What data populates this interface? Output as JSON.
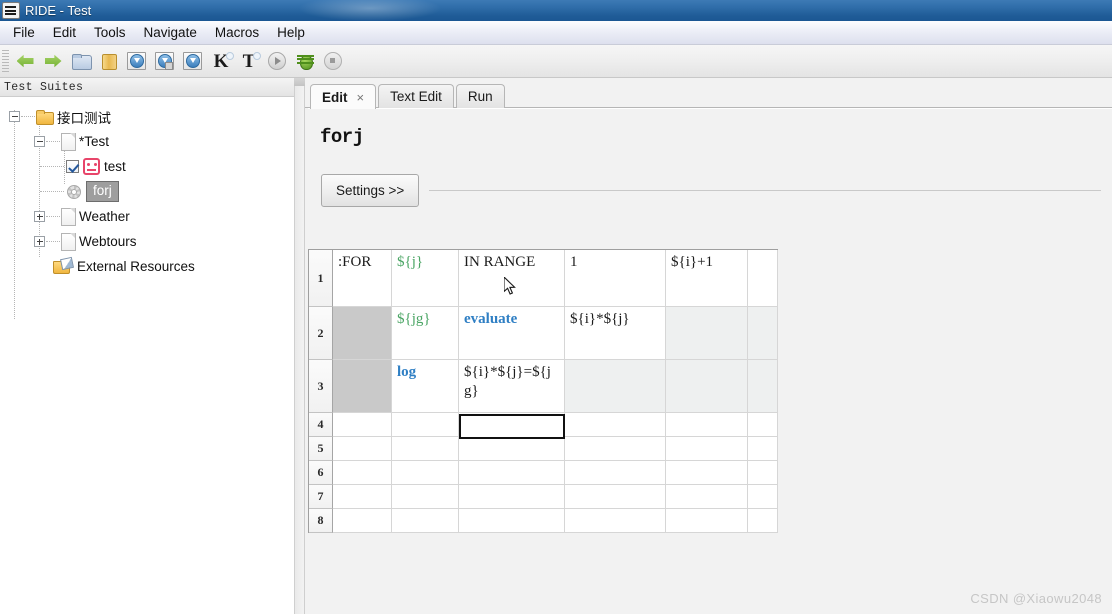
{
  "window": {
    "title": "RIDE - Test",
    "icon": "ride-app-icon"
  },
  "menubar": {
    "items": [
      {
        "label": "File"
      },
      {
        "label": "Edit"
      },
      {
        "label": "Tools"
      },
      {
        "label": "Navigate"
      },
      {
        "label": "Macros"
      },
      {
        "label": "Help"
      }
    ]
  },
  "toolbar": {
    "buttons": [
      {
        "name": "back-button",
        "icon": "arrow-left-icon"
      },
      {
        "name": "forward-button",
        "icon": "arrow-right-icon"
      },
      {
        "name": "open-directory-button",
        "icon": "folder-open-icon"
      },
      {
        "name": "open-file-button",
        "icon": "folder-yellow-icon"
      },
      {
        "name": "save-button",
        "icon": "save-icon"
      },
      {
        "name": "save-all-button",
        "icon": "save-all-icon"
      },
      {
        "name": "save-as-button",
        "icon": "save-as-icon"
      },
      {
        "name": "search-keyword-button",
        "icon": "letter-k-icon"
      },
      {
        "name": "search-tests-button",
        "icon": "letter-t-icon"
      },
      {
        "name": "run-button",
        "icon": "play-icon"
      },
      {
        "name": "debug-button",
        "icon": "bug-icon"
      },
      {
        "name": "stop-button",
        "icon": "stop-icon"
      }
    ]
  },
  "sidebar": {
    "header": "Test Suites",
    "tree": [
      {
        "label": "接口测试",
        "icon": "folder-icon",
        "expander": "minus",
        "level": 0
      },
      {
        "label": "*Test",
        "icon": "file-icon",
        "expander": "minus",
        "level": 1
      },
      {
        "label": "test",
        "icon": "robot-test-icon",
        "expander": "none",
        "level": 2,
        "checkbox": true
      },
      {
        "label": "forj",
        "icon": "gear-icon",
        "expander": "none",
        "level": 2,
        "selected": true
      },
      {
        "label": "Weather",
        "icon": "file-icon",
        "expander": "plus",
        "level": 1
      },
      {
        "label": "Webtours",
        "icon": "file-icon",
        "expander": "plus",
        "level": 1
      },
      {
        "label": "External Resources",
        "icon": "external-resources-icon",
        "expander": "none",
        "level": 1
      }
    ]
  },
  "editor": {
    "tabs": [
      {
        "label": "Edit",
        "active": true,
        "closable": true,
        "close_glyph": "×"
      },
      {
        "label": "Text Edit",
        "active": false,
        "closable": false
      },
      {
        "label": "Run",
        "active": false,
        "closable": false
      }
    ],
    "keyword_name": "forj",
    "settings_button": "Settings >>",
    "grid": {
      "row_numbers": [
        "1",
        "2",
        "3",
        "4",
        "5",
        "6",
        "7",
        "8"
      ],
      "rows": [
        {
          "num": "1",
          "tint": false,
          "cells": [
            {
              "text": ":FOR",
              "style": "plain"
            },
            {
              "text": "${j}",
              "style": "var"
            },
            {
              "text": "IN RANGE",
              "style": "plain"
            },
            {
              "text": "1",
              "style": "plain"
            },
            {
              "text": "${i}+1",
              "style": "plain"
            },
            {
              "text": "",
              "style": "plain"
            }
          ]
        },
        {
          "num": "2",
          "tint": true,
          "cells": [
            {
              "text": "",
              "style": "forbar"
            },
            {
              "text": "${jg}",
              "style": "var"
            },
            {
              "text": "evaluate",
              "style": "keyword"
            },
            {
              "text": "${i}*${j}",
              "style": "plain"
            },
            {
              "text": "",
              "style": "plain"
            },
            {
              "text": "",
              "style": "plain"
            }
          ]
        },
        {
          "num": "3",
          "tint": true,
          "cells": [
            {
              "text": "",
              "style": "forbar"
            },
            {
              "text": "log",
              "style": "keyword"
            },
            {
              "text": "${i}*${j}=${jg}",
              "style": "plain"
            },
            {
              "text": "",
              "style": "plain"
            },
            {
              "text": "",
              "style": "plain"
            },
            {
              "text": "",
              "style": "plain"
            }
          ]
        },
        {
          "num": "4",
          "tint": false,
          "cells": [
            {
              "text": "",
              "style": "plain"
            },
            {
              "text": "",
              "style": "plain"
            },
            {
              "text": "",
              "style": "plain"
            },
            {
              "text": "",
              "style": "plain"
            },
            {
              "text": "",
              "style": "plain"
            },
            {
              "text": "",
              "style": "plain"
            }
          ]
        },
        {
          "num": "5",
          "tint": false,
          "cells": [
            {
              "text": "",
              "style": "plain"
            },
            {
              "text": "",
              "style": "plain"
            },
            {
              "text": "",
              "style": "plain"
            },
            {
              "text": "",
              "style": "plain"
            },
            {
              "text": "",
              "style": "plain"
            },
            {
              "text": "",
              "style": "plain"
            }
          ]
        },
        {
          "num": "6",
          "tint": false,
          "cells": [
            {
              "text": "",
              "style": "plain"
            },
            {
              "text": "",
              "style": "plain"
            },
            {
              "text": "",
              "style": "plain"
            },
            {
              "text": "",
              "style": "plain"
            },
            {
              "text": "",
              "style": "plain"
            },
            {
              "text": "",
              "style": "plain"
            }
          ]
        },
        {
          "num": "7",
          "tint": false,
          "cells": [
            {
              "text": "",
              "style": "plain"
            },
            {
              "text": "",
              "style": "plain"
            },
            {
              "text": "",
              "style": "plain"
            },
            {
              "text": "",
              "style": "plain"
            },
            {
              "text": "",
              "style": "plain"
            },
            {
              "text": "",
              "style": "plain"
            }
          ]
        },
        {
          "num": "8",
          "tint": false,
          "cells": [
            {
              "text": "",
              "style": "plain"
            },
            {
              "text": "",
              "style": "plain"
            },
            {
              "text": "",
              "style": "plain"
            },
            {
              "text": "",
              "style": "plain"
            },
            {
              "text": "",
              "style": "plain"
            },
            {
              "text": "",
              "style": "plain"
            }
          ]
        }
      ],
      "selected_cell": {
        "row": "4",
        "column": "2"
      }
    }
  },
  "watermark": "CSDN @Xiaowu2048",
  "colors": {
    "titlebar": "#2f6da9",
    "variable_green": "#4aa564",
    "keyword_blue": "#2f7fc4",
    "selection_gray": "#9e9e9e",
    "for_bar_gray": "#c9c9c9",
    "row_tint": "#eef0f0"
  }
}
